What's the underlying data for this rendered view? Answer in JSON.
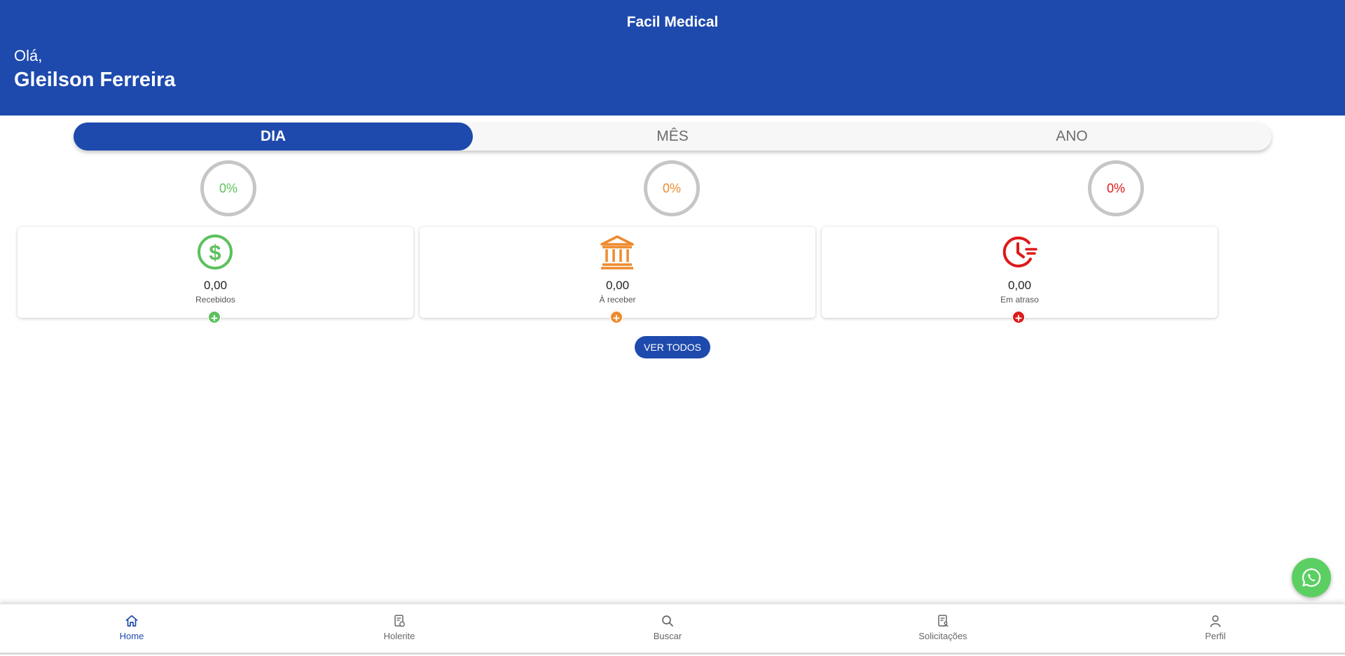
{
  "header": {
    "app_title": "Facil Medical",
    "greeting": "Olá,",
    "user_name": "Gleilson Ferreira",
    "background_color": "#1e4aad"
  },
  "period_tabs": [
    {
      "label": "DIA",
      "active": true
    },
    {
      "label": "MÊS",
      "active": false
    },
    {
      "label": "ANO",
      "active": false
    }
  ],
  "stats": [
    {
      "percent": "0%",
      "value": "0,00",
      "label": "Recebidos",
      "color": "#5cc15c",
      "icon": "dollar-icon"
    },
    {
      "percent": "0%",
      "value": "0,00",
      "label": "À receber",
      "color": "#ee8a2e",
      "icon": "bank-icon"
    },
    {
      "percent": "0%",
      "value": "0,00",
      "label": "Em atraso",
      "color": "#dd1a1a",
      "icon": "overdue-clock-icon"
    }
  ],
  "actions": {
    "view_all": "VER TODOS",
    "add_symbol": "+"
  },
  "bottom_nav": [
    {
      "label": "Home",
      "icon": "home-icon",
      "active": true
    },
    {
      "label": "Holerite",
      "icon": "payslip-icon",
      "active": false
    },
    {
      "label": "Buscar",
      "icon": "search-icon",
      "active": false
    },
    {
      "label": "Solicitações",
      "icon": "requests-icon",
      "active": false
    },
    {
      "label": "Perfil",
      "icon": "profile-icon",
      "active": false
    }
  ],
  "colors": {
    "primary": "#1e4aad",
    "whatsapp": "#5ccf63"
  }
}
